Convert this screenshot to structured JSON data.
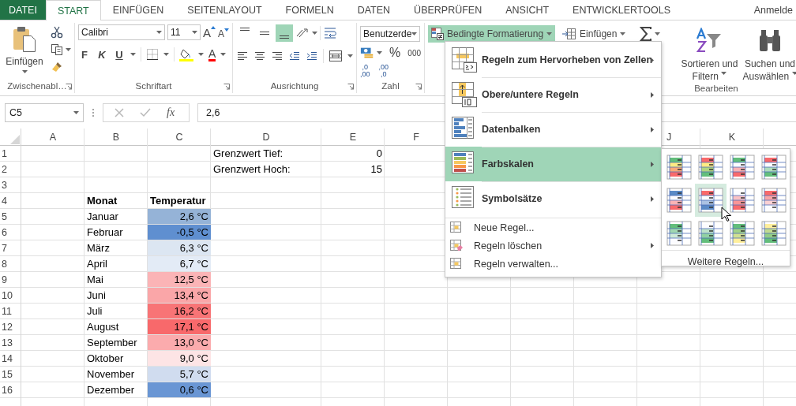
{
  "tabs": [
    {
      "label": "DATEI",
      "kind": "file",
      "selected": false
    },
    {
      "label": "START",
      "kind": "tab",
      "selected": true
    },
    {
      "label": "EINFÜGEN",
      "kind": "tab",
      "selected": false
    },
    {
      "label": "SEITENLAYOUT",
      "kind": "tab",
      "selected": false
    },
    {
      "label": "FORMELN",
      "kind": "tab",
      "selected": false
    },
    {
      "label": "DATEN",
      "kind": "tab",
      "selected": false
    },
    {
      "label": "ÜBERPRÜFEN",
      "kind": "tab",
      "selected": false
    },
    {
      "label": "ANSICHT",
      "kind": "tab",
      "selected": false
    },
    {
      "label": "ENTWICKLERTOOLS",
      "kind": "tab",
      "selected": false
    }
  ],
  "account": "Anmelde",
  "ribbon": {
    "clipboard": {
      "paste": "Einfügen",
      "label": "Zwischenabl…"
    },
    "font": {
      "name": "Calibri",
      "size": "11",
      "grow": "A",
      "shrink": "A",
      "styles": [
        "F",
        "K",
        "U"
      ],
      "color_button": "A",
      "label": "Schriftart"
    },
    "alignment": {
      "vertical": [
        {
          "kind": "top",
          "selected": false
        },
        {
          "kind": "middle",
          "selected": false
        },
        {
          "kind": "bottom",
          "selected": true
        }
      ],
      "label": "Ausrichtung"
    },
    "number": {
      "format": "Benutzerde",
      "percent": "%",
      "thousands": "000",
      "decimals": [
        {
          "top": ",0",
          "bottom": ",00"
        },
        {
          "top": ",00",
          "bottom": ",0"
        }
      ],
      "label": "Zahl"
    },
    "conditional_formatting": {
      "label": "Bedingte Formatierung",
      "open": true
    },
    "cells_insert": "Einfügen",
    "editing": {
      "sort": [
        "Sortieren und",
        "Filtern"
      ],
      "find": [
        "Suchen und",
        "Auswählen"
      ],
      "label": "Bearbeiten"
    }
  },
  "formula_bar": {
    "name_box": "C5",
    "function": "fx",
    "formula": "2,6"
  },
  "sheet": {
    "columns": [
      "A",
      "B",
      "C",
      "D",
      "E",
      "F"
    ],
    "columns_after_menu": [
      "J",
      "K"
    ],
    "row_headers": [
      "1",
      "2",
      "3",
      "4",
      "5",
      "6",
      "7",
      "8",
      "9",
      "10",
      "11",
      "12",
      "13",
      "14",
      "15",
      "16"
    ],
    "limits": [
      {
        "label": "Grenzwert Tief:",
        "value": "0"
      },
      {
        "label": "Grenzwert Hoch:",
        "value": "15"
      }
    ],
    "table": {
      "columns": [
        "Monat",
        "Temperatur"
      ],
      "rows": [
        {
          "month": "Januar",
          "temperature": "2,6 °C",
          "color": "#95b3d7"
        },
        {
          "month": "Februar",
          "temperature": "-0,5 °C",
          "color": "#5f8fd0"
        },
        {
          "month": "März",
          "temperature": "6,3 °C",
          "color": "#dce6f2"
        },
        {
          "month": "April",
          "temperature": "6,7 °C",
          "color": "#e3ebf6"
        },
        {
          "month": "Mai",
          "temperature": "12,5 °C",
          "color": "#fbb4b6"
        },
        {
          "month": "Juni",
          "temperature": "13,4 °C",
          "color": "#faa6a8"
        },
        {
          "month": "Juli",
          "temperature": "16,2 °C",
          "color": "#f87476"
        },
        {
          "month": "August",
          "temperature": "17,1 °C",
          "color": "#f8696b"
        },
        {
          "month": "September",
          "temperature": "13,0 °C",
          "color": "#fbabad"
        },
        {
          "month": "Oktober",
          "temperature": "9,0 °C",
          "color": "#fde4e5"
        },
        {
          "month": "November",
          "temperature": "5,7 °C",
          "color": "#d0dcef"
        },
        {
          "month": "Dezember",
          "temperature": "0,6 °C",
          "color": "#6a96d4"
        }
      ]
    }
  },
  "menu": {
    "items": [
      {
        "label": "Regeln zum Hervorheben von Zellen",
        "kind": "highlight",
        "submenu": true,
        "selected": false
      },
      {
        "label": "Obere/untere Regeln",
        "kind": "topbottom",
        "submenu": true,
        "selected": false
      },
      {
        "label": "Datenbalken",
        "kind": "databars",
        "submenu": true,
        "selected": false
      },
      {
        "label": "Farbskalen",
        "kind": "colorscales",
        "submenu": true,
        "selected": true
      },
      {
        "label": "Symbolsätze",
        "kind": "iconsets",
        "submenu": true,
        "selected": false
      }
    ],
    "small_items": [
      {
        "label": "Neue Regel...",
        "kind": "new",
        "submenu": false
      },
      {
        "label": "Regeln löschen",
        "kind": "clear",
        "submenu": true
      },
      {
        "label": "Regeln verwalten...",
        "kind": "manage",
        "submenu": false
      }
    ]
  },
  "submenu": {
    "swatches": [
      {
        "kind": "gyr",
        "selected": false
      },
      {
        "kind": "ryg",
        "selected": false
      },
      {
        "kind": "gwr",
        "selected": false
      },
      {
        "kind": "rwg",
        "selected": false
      },
      {
        "kind": "bwr",
        "selected": false
      },
      {
        "kind": "rwb",
        "selected": true
      },
      {
        "kind": "wr",
        "selected": false
      },
      {
        "kind": "rw",
        "selected": false
      },
      {
        "kind": "gw",
        "selected": false
      },
      {
        "kind": "wg",
        "selected": false
      },
      {
        "kind": "gy",
        "selected": false
      },
      {
        "kind": "yg",
        "selected": false
      }
    ],
    "more": "Weitere Regeln..."
  }
}
